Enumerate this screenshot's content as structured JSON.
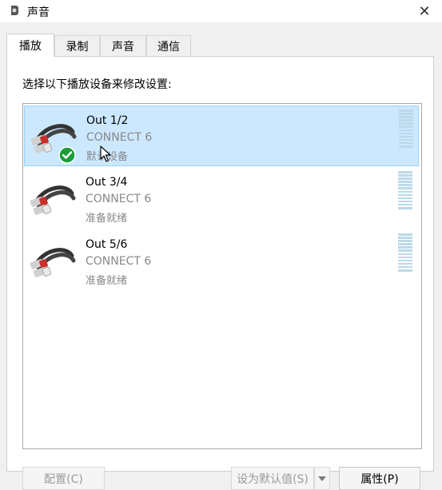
{
  "window": {
    "title": "声音",
    "close_glyph": "✕"
  },
  "tabs": [
    {
      "label": "播放",
      "active": true
    },
    {
      "label": "录制",
      "active": false
    },
    {
      "label": "声音",
      "active": false
    },
    {
      "label": "通信",
      "active": false
    }
  ],
  "playback": {
    "instruction": "选择以下播放设备来修改设置:",
    "devices": [
      {
        "name": "Out 1/2",
        "subtitle": "CONNECT 6",
        "status": "默认设备",
        "selected": true,
        "default": true,
        "icon": "rca-cable-icon"
      },
      {
        "name": "Out 3/4",
        "subtitle": "CONNECT 6",
        "status": "准备就绪",
        "selected": false,
        "default": false,
        "icon": "rca-cable-icon"
      },
      {
        "name": "Out 5/6",
        "subtitle": "CONNECT 6",
        "status": "准备就绪",
        "selected": false,
        "default": false,
        "icon": "rca-cable-icon"
      }
    ]
  },
  "buttons": {
    "configure": "配置(C)",
    "set_default": "设为默认值(S)",
    "properties": "属性(P)"
  },
  "colors": {
    "selection_bg": "#cce8ff",
    "selection_border": "#99d1ff",
    "check_green": "#1a9c3a"
  }
}
